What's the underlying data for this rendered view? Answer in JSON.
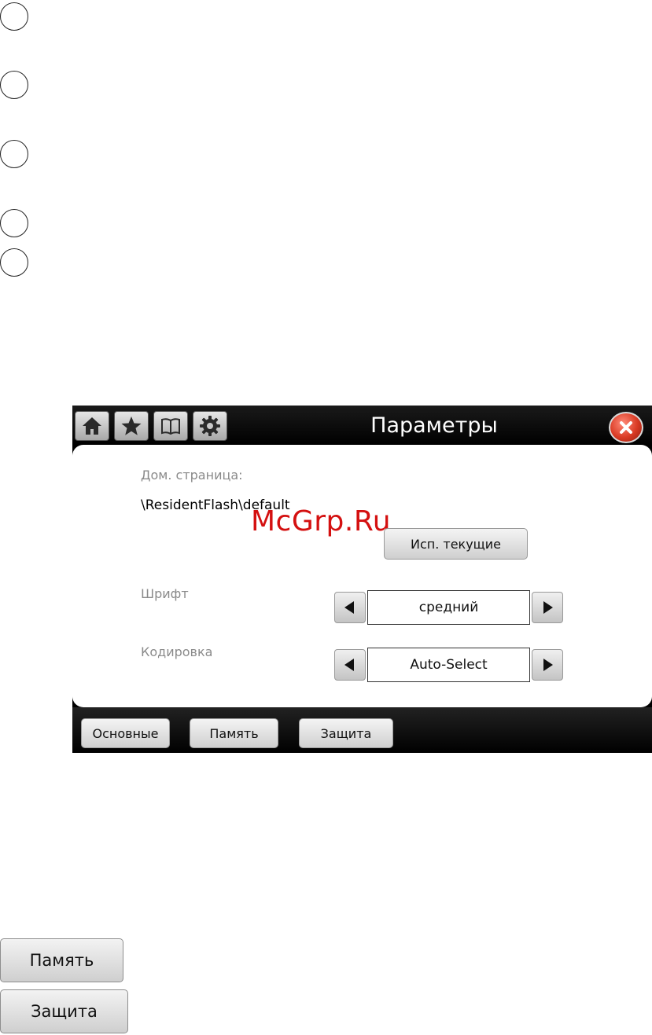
{
  "window": {
    "title": "Параметры",
    "icons": [
      "home-icon",
      "star-icon",
      "book-icon",
      "gear-icon",
      "close-icon"
    ]
  },
  "settings": {
    "home_label": "Дом. страница:",
    "home_value": "\\ResidentFlash\\default",
    "use_current_button": "Исп. текущие",
    "font_label": "Шрифт",
    "font_value": "средний",
    "encoding_label": "Кодировка",
    "encoding_value": "Auto-Select"
  },
  "watermark": "McGrp.Ru",
  "tabs": [
    {
      "label": "Основные"
    },
    {
      "label": "Память"
    },
    {
      "label": "Защита"
    }
  ],
  "standalone_buttons": {
    "memory": "Память",
    "security": "Защита"
  },
  "colors": {
    "titlebar": "#000000",
    "close": "#d93a24",
    "watermark": "#d41010",
    "label": "#8a8a8a"
  }
}
